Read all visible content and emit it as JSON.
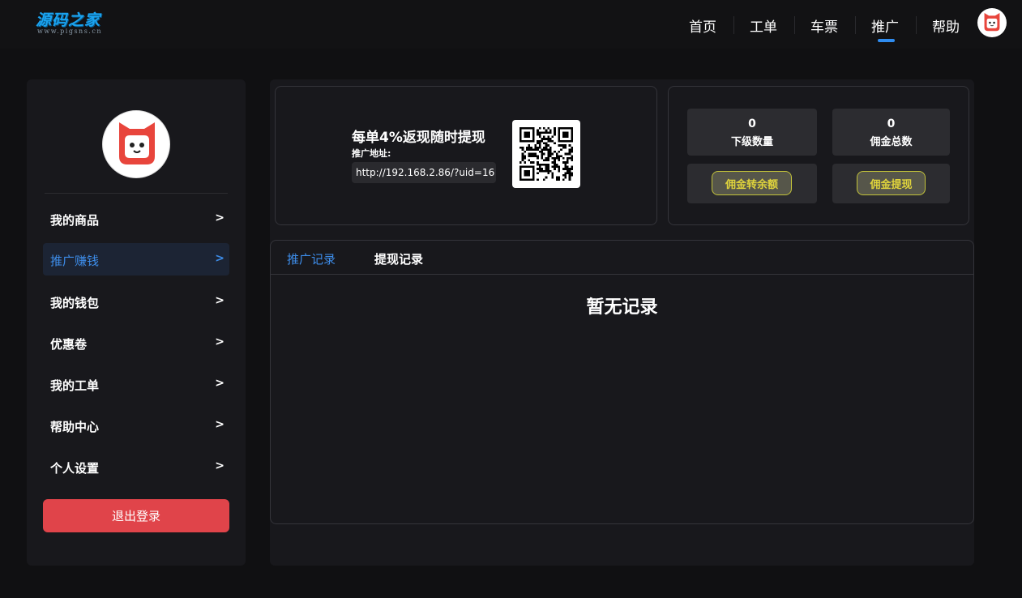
{
  "header": {
    "logo_text": "源码之家",
    "logo_sub": "www.pigsns.cn",
    "nav": [
      "首页",
      "工单",
      "车票",
      "推广",
      "帮助"
    ],
    "active_nav": "推广"
  },
  "sidebar": {
    "items": [
      {
        "label": "我的商品",
        "arrow": ">"
      },
      {
        "label": "推广赚钱",
        "arrow": ">"
      },
      {
        "label": "我的钱包",
        "arrow": ">"
      },
      {
        "label": "优惠卷",
        "arrow": ">"
      },
      {
        "label": "我的工单",
        "arrow": ">"
      },
      {
        "label": "帮助中心",
        "arrow": ">"
      },
      {
        "label": "个人设置",
        "arrow": ">"
      }
    ],
    "active_item": "推广赚钱",
    "logout_label": "退出登录"
  },
  "promo": {
    "title": "每单4%返现随时提现",
    "address_label": "推广地址:",
    "url": "http://192.168.2.86/?uid=16"
  },
  "stats": {
    "subordinates": {
      "value": "0",
      "label": "下级数量"
    },
    "commission_total": {
      "value": "0",
      "label": "佣金总数"
    },
    "transfer_label": "佣金转余额",
    "withdraw_label": "佣金提现"
  },
  "records": {
    "tabs": [
      "推广记录",
      "提现记录"
    ],
    "active_tab": "推广记录",
    "empty_text": "暂无记录"
  },
  "colors": {
    "accent": "#3d8ce8",
    "logout": "#e0444a",
    "action_text": "#e0d43c"
  }
}
